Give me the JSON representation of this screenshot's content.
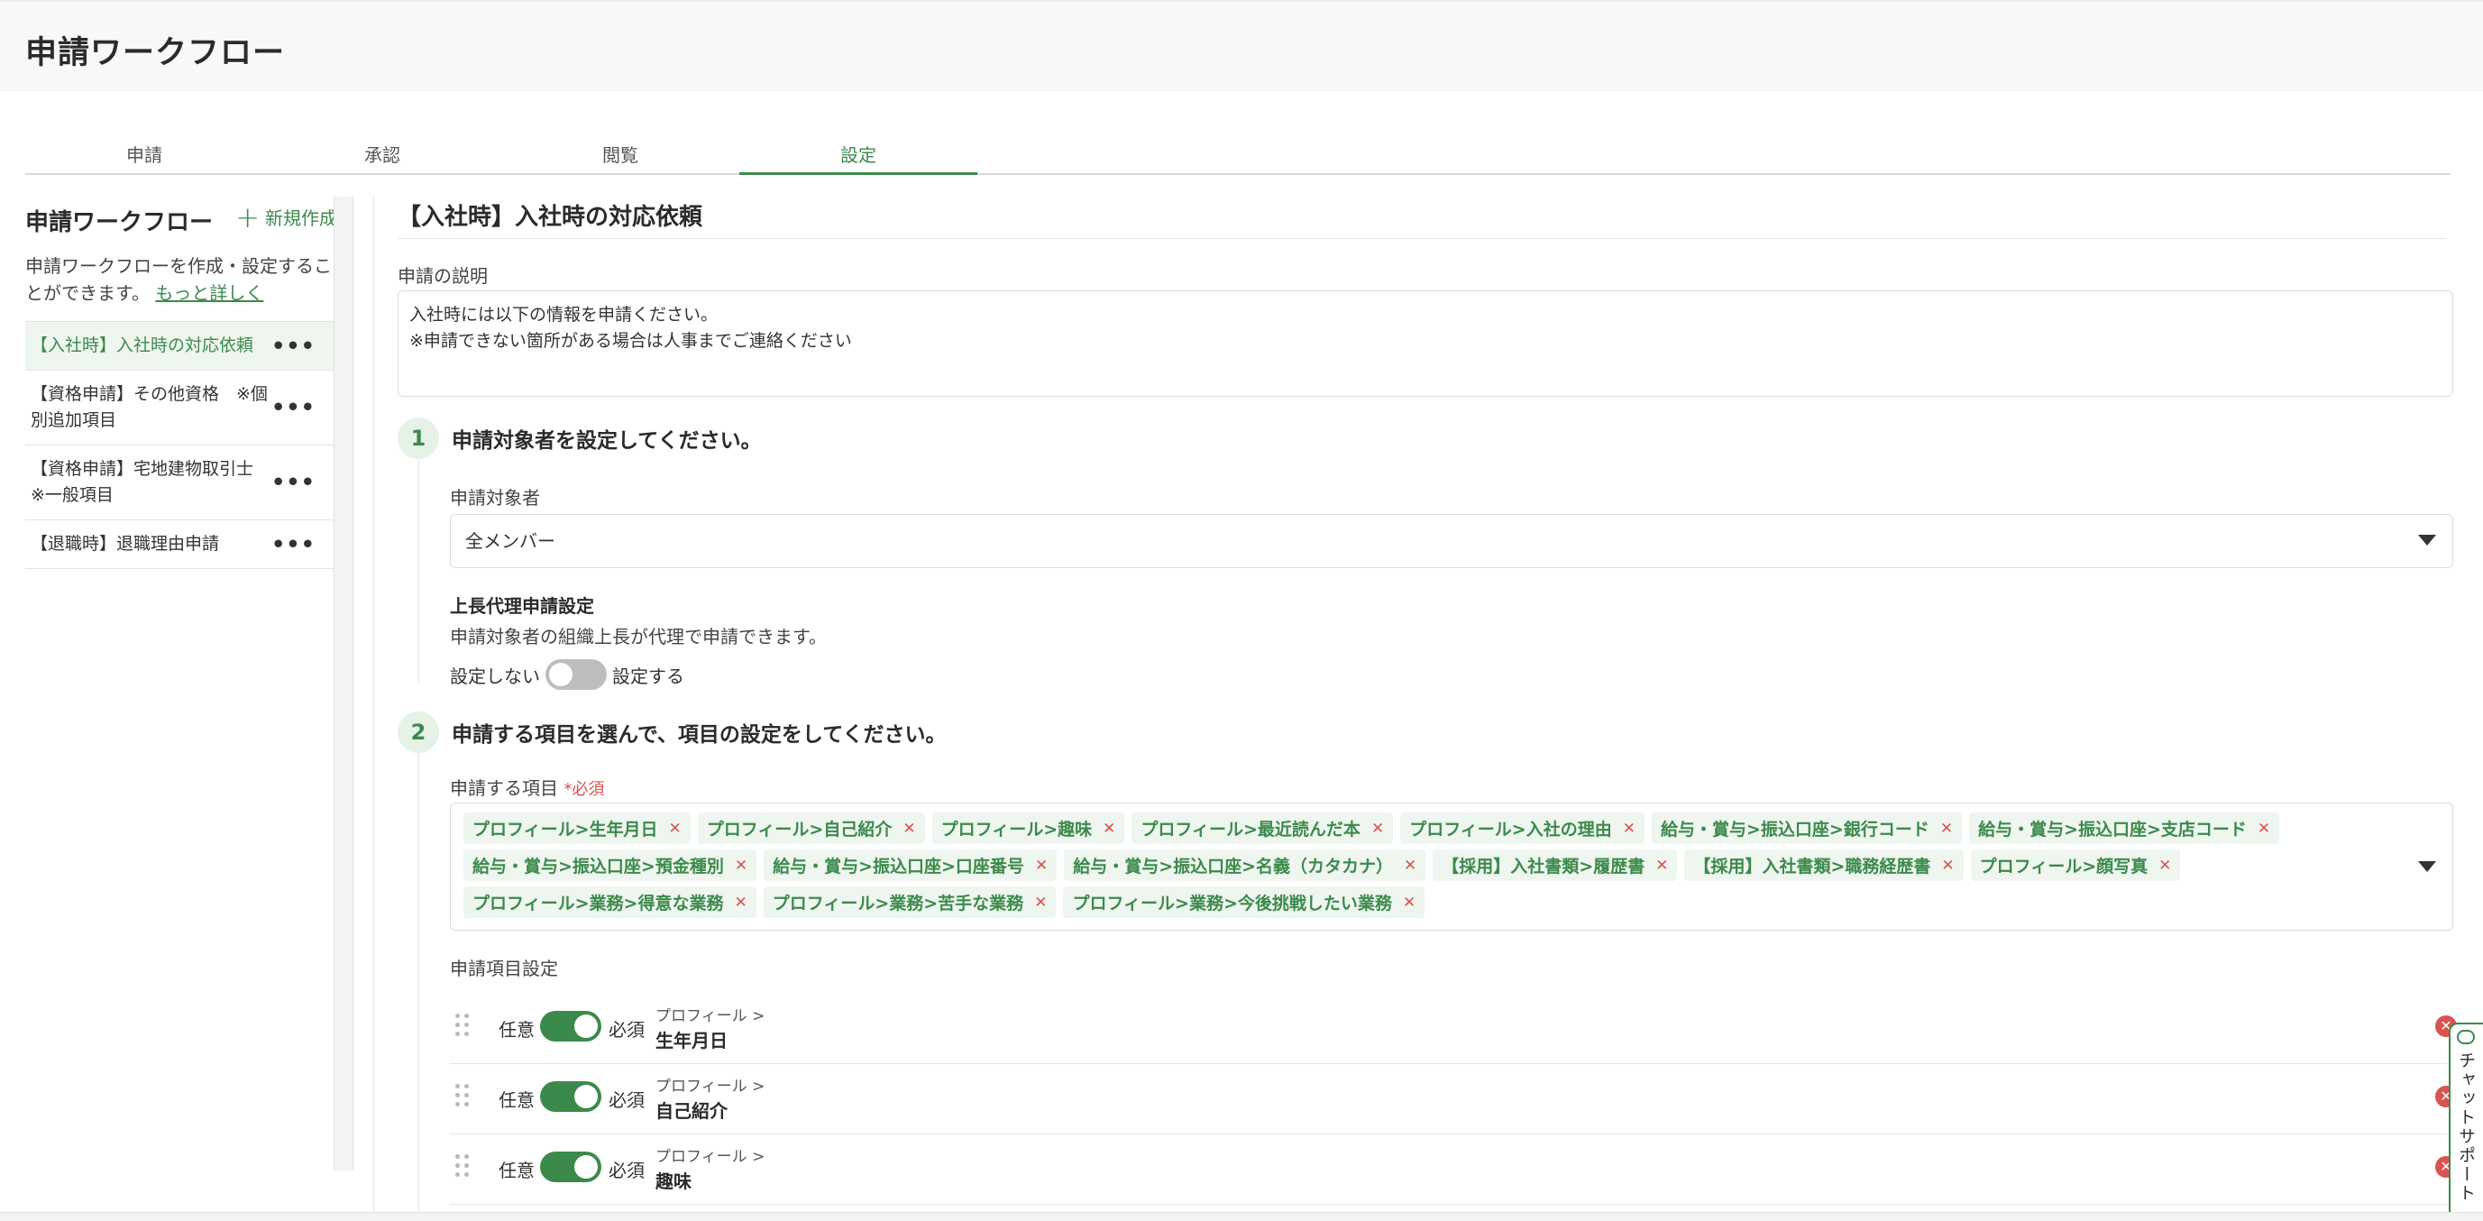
{
  "header": {
    "title": "申請ワークフロー"
  },
  "tabs": [
    {
      "label": "申請"
    },
    {
      "label": "承認"
    },
    {
      "label": "閲覧"
    },
    {
      "label": "設定"
    }
  ],
  "sidebar": {
    "title": "申請ワークフロー",
    "new_button": "新規作成",
    "description": "申請ワークフローを作成・設定することができます。",
    "more_link": "もっと詳しく",
    "items": [
      {
        "label": "【入社時】入社時の対応依頼"
      },
      {
        "label": "【資格申請】その他資格　※個別追加項目"
      },
      {
        "label": "【資格申請】宅地建物取引士　※一般項目"
      },
      {
        "label": "【退職時】退職理由申請"
      }
    ]
  },
  "main": {
    "title": "【入社時】入社時の対応依頼",
    "description_label": "申請の説明",
    "description_line1": "入社時には以下の情報を申請ください。",
    "description_line2": "※申請できない箇所がある場合は人事までご連絡ください",
    "step1": {
      "number": "1",
      "text": "申請対象者を設定してください。",
      "target_label": "申請対象者",
      "target_value": "全メンバー",
      "proxy_title": "上長代理申請設定",
      "proxy_desc": "申請対象者の組織上長が代理で申請できます。",
      "toggle_off_label": "設定しない",
      "toggle_on_label": "設定する"
    },
    "step2": {
      "number": "2",
      "text": "申請する項目を選んで、項目の設定をしてください。",
      "items_label": "申請する項目",
      "required_mark": "*必須",
      "tags": [
        "プロフィール>生年月日",
        "プロフィール>自己紹介",
        "プロフィール>趣味",
        "プロフィール>最近読んだ本",
        "プロフィール>入社の理由",
        "給与・賞与>振込口座>銀行コード",
        "給与・賞与>振込口座>支店コード",
        "給与・賞与>振込口座>預金種別",
        "給与・賞与>振込口座>口座番号",
        "給与・賞与>振込口座>名義（カタカナ）",
        "【採用】入社書類>履歴書",
        "【採用】入社書類>職務経歴書",
        "プロフィール>顔写真",
        "プロフィール>業務>得意な業務",
        "プロフィール>業務>苦手な業務",
        "プロフィール>業務>今後挑戦したい業務"
      ],
      "settings_label": "申請項目設定",
      "rows": [
        {
          "optional": "任意",
          "required": "必須",
          "path": "プロフィール >",
          "name": "生年月日"
        },
        {
          "optional": "任意",
          "required": "必須",
          "path": "プロフィール >",
          "name": "自己紹介"
        },
        {
          "optional": "任意",
          "required": "必須",
          "path": "プロフィール >",
          "name": "趣味"
        }
      ]
    }
  },
  "chat_support": "チャットサポート",
  "colors": {
    "accent": "#3c8a4b",
    "danger": "#d9534f",
    "accent_light": "#eef6ef"
  }
}
